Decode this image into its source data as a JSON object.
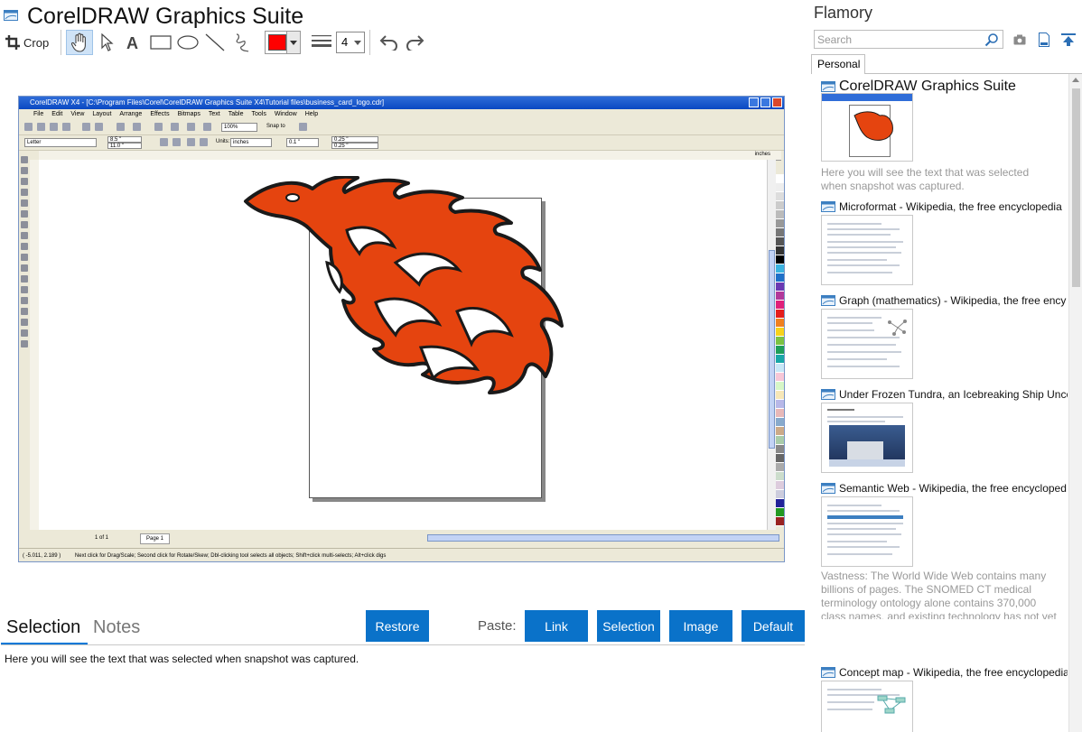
{
  "app": {
    "title": "CorelDRAW Graphics Suite"
  },
  "toolbar": {
    "crop_label": "Crop",
    "line_width": "4",
    "stroke_color": "#ff0000",
    "tools": [
      "hand-icon",
      "pointer-icon",
      "text-icon",
      "rectangle-icon",
      "ellipse-icon",
      "line-icon",
      "freehand-icon",
      "undo-icon",
      "redo-icon"
    ]
  },
  "snapshot": {
    "window_title": "CorelDRAW X4 - [C:\\Program Files\\Corel\\CorelDRAW Graphics Suite X4\\Tutorial files\\business_card_logo.cdr]",
    "menu": [
      "File",
      "Edit",
      "View",
      "Layout",
      "Arrange",
      "Effects",
      "Bitmaps",
      "Text",
      "Table",
      "Tools",
      "Window",
      "Help"
    ],
    "zoom": "100%",
    "snap_to": "Snap to",
    "paper": "Letter",
    "width": "8.5 \"",
    "height": "11.0 \"",
    "units_label": "Units:",
    "units": "inches",
    "nudge": "0.1 \"",
    "dup_x": "0.25 \"",
    "dup_y": "0.25 \"",
    "ruler_unit": "inches",
    "page_count": "1 of 1",
    "page_tab": "Page 1",
    "status_coords": "( -5.011, 2.189 )",
    "status_hint": "Next click for Drag/Scale; Second click for Rotate/Skew; Dbl-clicking tool selects all objects; Shift+click multi-selects; Alt+click digs",
    "logo_color": "#e5440f"
  },
  "bottom": {
    "tabs": [
      "Selection",
      "Notes"
    ],
    "active_tab": "Selection",
    "restore_label": "Restore",
    "paste_label": "Paste:",
    "paste_buttons": [
      "Link",
      "Selection",
      "Image",
      "Default"
    ],
    "selection_text": "Here you will see the text that was selected when snapshot was captured."
  },
  "panel": {
    "title": "Flamory",
    "search_placeholder": "Search",
    "tab": "Personal",
    "items": [
      {
        "title": "CorelDRAW Graphics Suite",
        "desc": "Here you will see the text that was selected when snapshot was captured."
      },
      {
        "title": "Microformat - Wikipedia, the free encyclopedia"
      },
      {
        "title": "Graph (mathematics) - Wikipedia, the free ency"
      },
      {
        "title": "Under Frozen Tundra, an Icebreaking Ship Unco"
      },
      {
        "title": "Semantic Web - Wikipedia, the free encycloped",
        "desc": "Vastness: The World Wide Web contains many billions of pages. The SNOMED CT medical terminology ontology alone contains 370,000 class names, and existing technology has not yet been able to eliminate all semantically duplicated terms. Any automated reasoning system will have to deal with truly huge inputs."
      },
      {
        "title": "Concept map - Wikipedia, the free encyclopedia"
      }
    ]
  },
  "colors": {
    "accent": "#0a72c9",
    "tab_underline": "#0078d7"
  }
}
